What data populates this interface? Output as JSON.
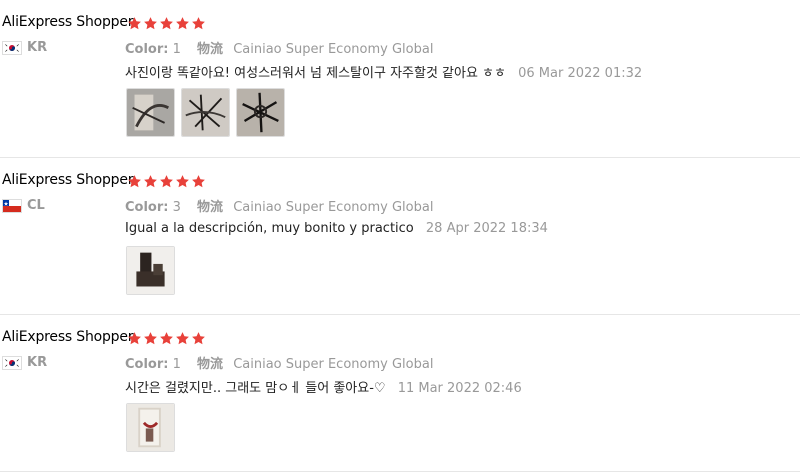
{
  "star_color": "#e8413a",
  "reviews": [
    {
      "author": "AliExpress Shopper",
      "rating": 5,
      "country_code": "KR",
      "flag": "south-korea-flag",
      "color_label": "Color:",
      "color_value": "1",
      "shipping_label": "物流",
      "shipping_value": "Cainiao Super Economy Global",
      "text": "사진이랑 똑같아요! 여성스러워서 넘 제스탈이구 자주할것 같아요 ㅎㅎ",
      "date": "06 Mar 2022 01:32",
      "photo_count": 3
    },
    {
      "author": "AliExpress Shopper",
      "rating": 5,
      "country_code": "CL",
      "flag": "chile-flag",
      "color_label": "Color:",
      "color_value": "3",
      "shipping_label": "物流",
      "shipping_value": "Cainiao Super Economy Global",
      "text": "Igual a la descripción, muy bonito y practico",
      "date": "28 Apr 2022 18:34",
      "photo_count": 1
    },
    {
      "author": "AliExpress Shopper",
      "rating": 5,
      "country_code": "KR",
      "flag": "south-korea-flag",
      "color_label": "Color:",
      "color_value": "1",
      "shipping_label": "物流",
      "shipping_value": "Cainiao Super Economy Global",
      "text": "시간은 걸렸지만.. 그래도 맘ㅇㅔ 들어 좋아요-♡",
      "date": "11 Mar 2022 02:46",
      "photo_count": 1
    }
  ]
}
